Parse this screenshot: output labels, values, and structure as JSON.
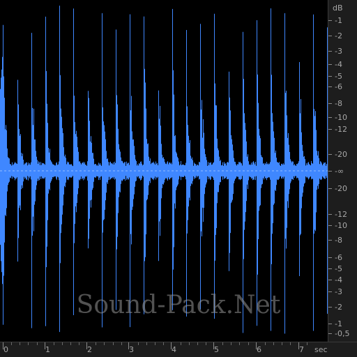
{
  "watermark": "Sound-Pack.Net",
  "colors": {
    "waveform": "#3f87ff",
    "background": "#000000",
    "ruler_bg": "#1d1d1d",
    "ruler_text": "#a8a8a8",
    "centerline": "#d0e0ff"
  },
  "db_scale": {
    "unit": "dB",
    "labels": [
      "-1",
      "-2",
      "-3",
      "-4",
      "-5",
      "-6",
      "-8",
      "-10",
      "-12",
      "-20",
      "-∞",
      "-20",
      "-12",
      "-10",
      "-8",
      "-6",
      "-5",
      "-4",
      "-3",
      "-2",
      "-1",
      "-0,5"
    ]
  },
  "time_scale": {
    "unit": "sec",
    "labels": [
      "0",
      "1",
      "2",
      "3",
      "4",
      "5",
      "6",
      "7"
    ]
  },
  "waveform": {
    "beats_per_second": 3,
    "duration_sec": 7.6
  }
}
